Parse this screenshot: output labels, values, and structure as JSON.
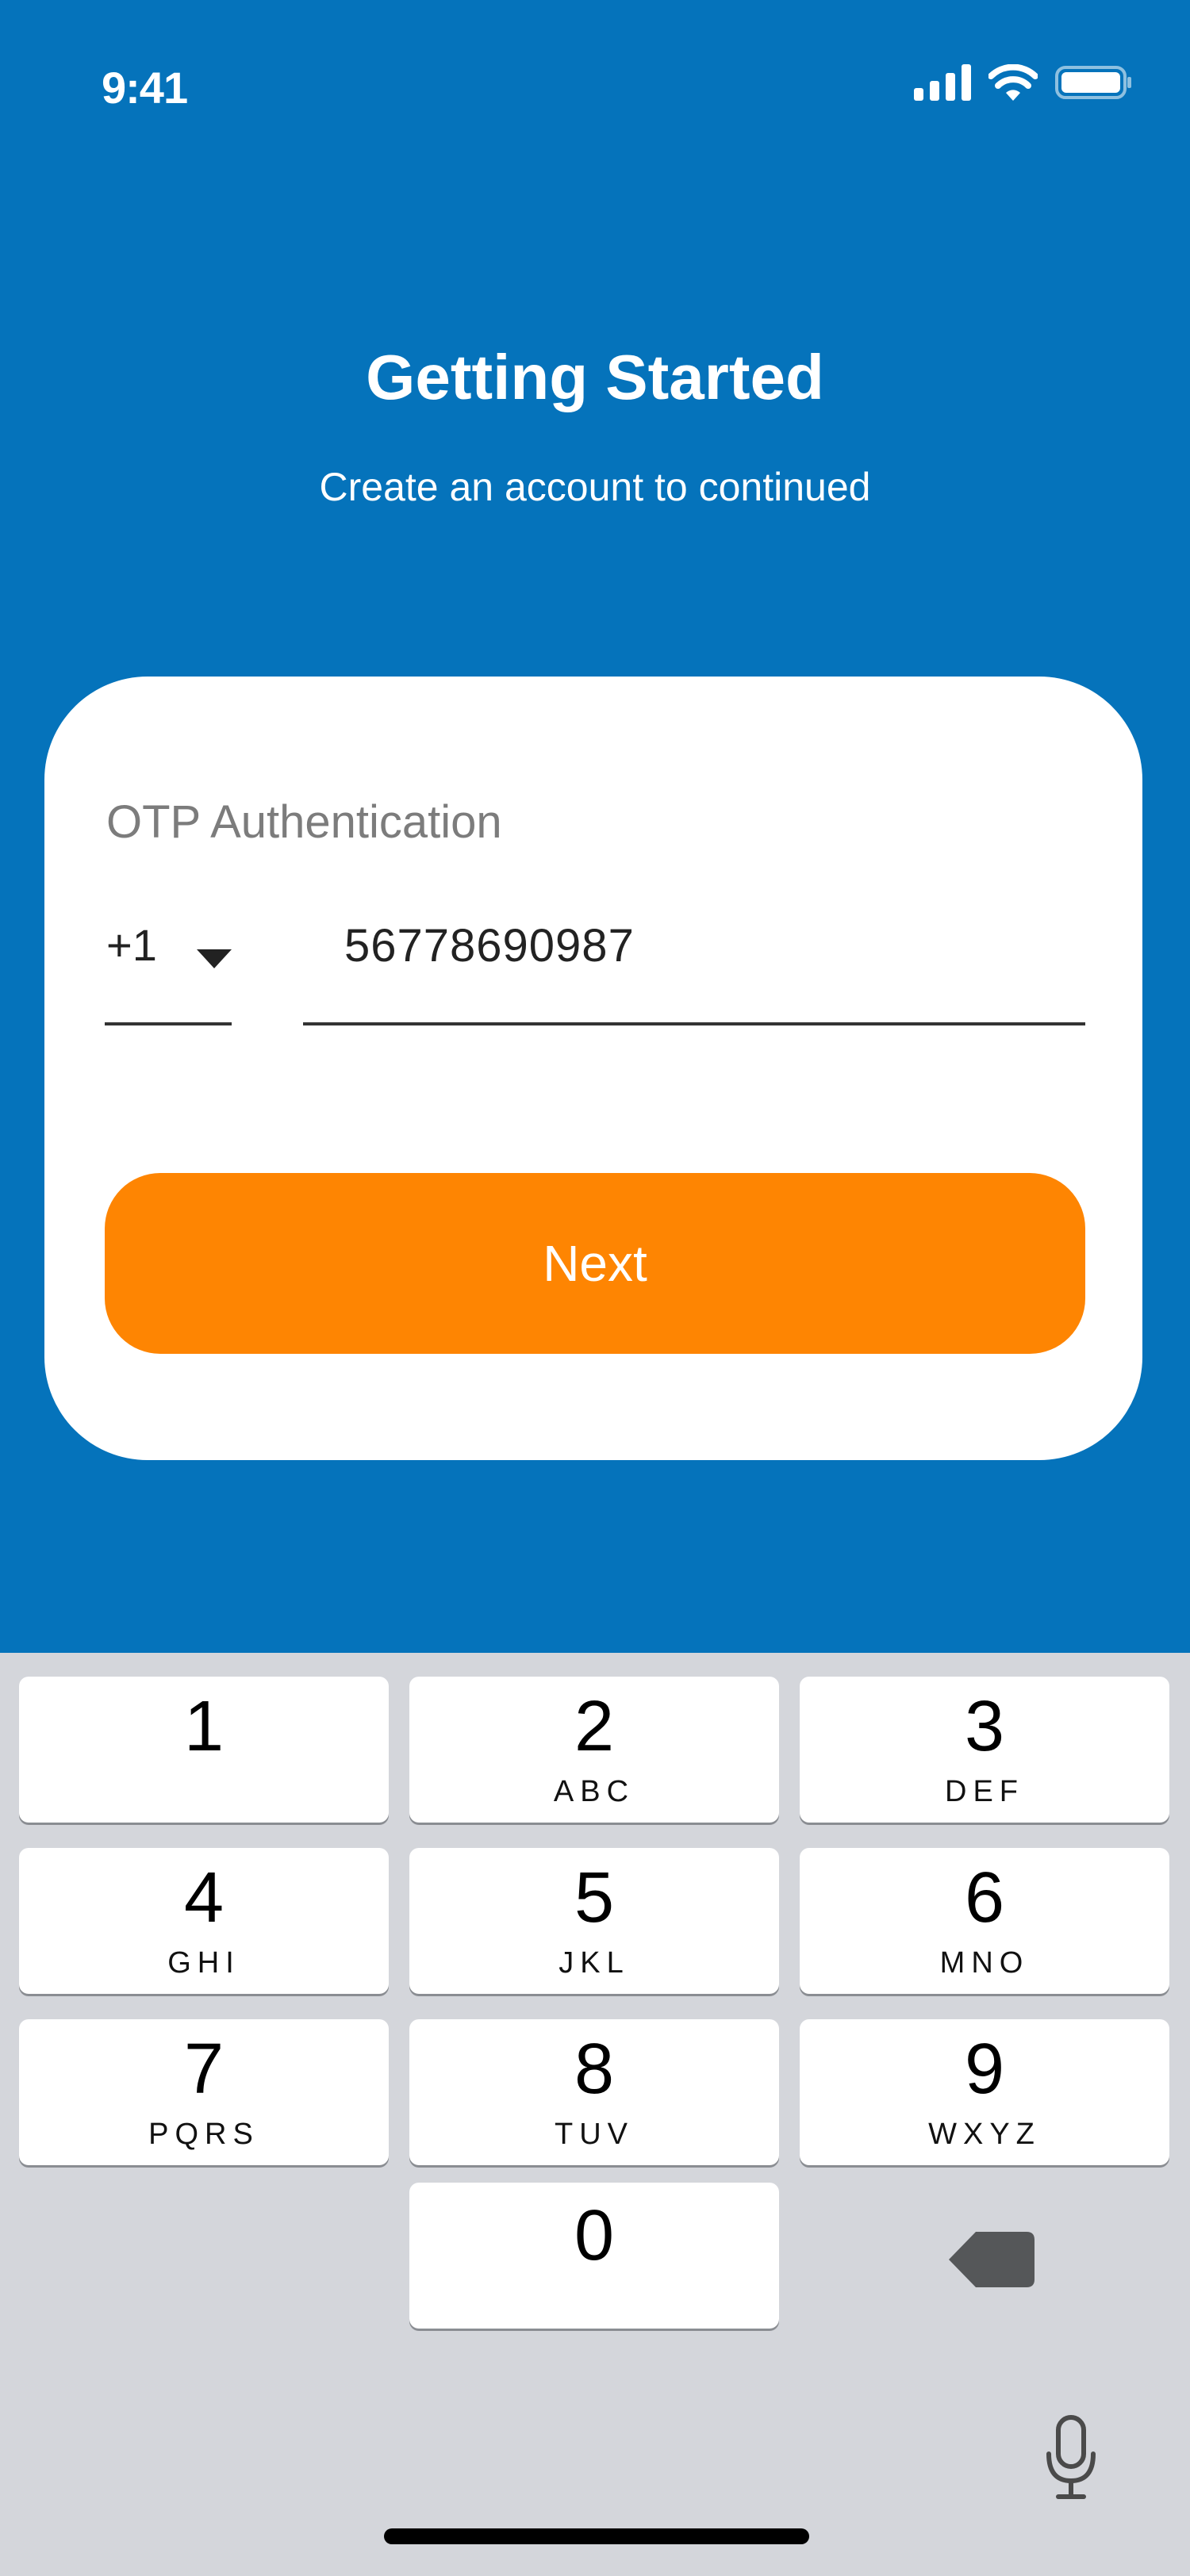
{
  "status_bar": {
    "time": "9:41",
    "icons": [
      "cellular-signal-icon",
      "wifi-icon",
      "battery-icon"
    ]
  },
  "header": {
    "title": "Getting Started",
    "subtitle": "Create an account to continued"
  },
  "form": {
    "section_label": "OTP Authentication",
    "country_code": "+1",
    "phone_value": "56778690987",
    "next_label": "Next"
  },
  "keyboard": {
    "keys": [
      {
        "digit": "1",
        "letters": ""
      },
      {
        "digit": "2",
        "letters": "ABC"
      },
      {
        "digit": "3",
        "letters": "DEF"
      },
      {
        "digit": "4",
        "letters": "GHI"
      },
      {
        "digit": "5",
        "letters": "JKL"
      },
      {
        "digit": "6",
        "letters": "MNO"
      },
      {
        "digit": "7",
        "letters": "PQRS"
      },
      {
        "digit": "8",
        "letters": "TUV"
      },
      {
        "digit": "9",
        "letters": "WXYZ"
      },
      {
        "digit": "0",
        "letters": ""
      }
    ],
    "icons": [
      "backspace-icon",
      "microphone-icon"
    ]
  },
  "colors": {
    "background": "#0573BB",
    "card": "#FFFFFF",
    "accent_button": "#FE8502",
    "keyboard_bg": "#D4D6DB"
  }
}
